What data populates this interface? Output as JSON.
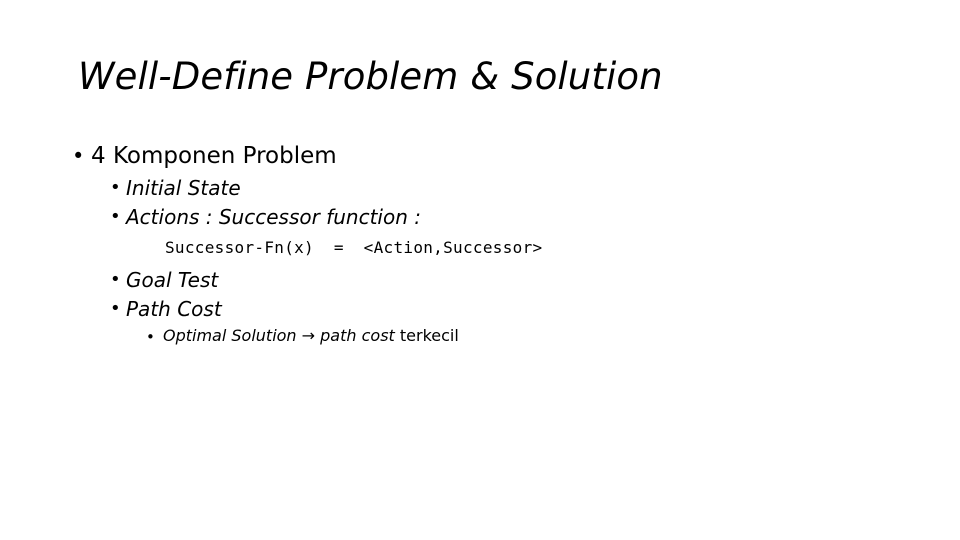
{
  "slide": {
    "title": "Well-Define Problem & Solution",
    "background_color": "#FFFFFF",
    "text_color": "#000000",
    "bullet_glyph": "•",
    "arrow_glyph": "→"
  },
  "outline": {
    "level1": {
      "text": "4 Komponen Problem"
    },
    "level2": [
      {
        "text": "Initial State"
      },
      {
        "text": "Actions : Successor function :"
      },
      {
        "text": "Goal Test"
      },
      {
        "text": "Path Cost"
      }
    ],
    "code": {
      "text": "Successor-Fn(x)  =  <Action,Successor>"
    },
    "level3": {
      "run_italic_1": "Optimal Solution ",
      "arrow": "→",
      "run_italic_2": " path cost ",
      "run_normal": "terkecil"
    }
  }
}
